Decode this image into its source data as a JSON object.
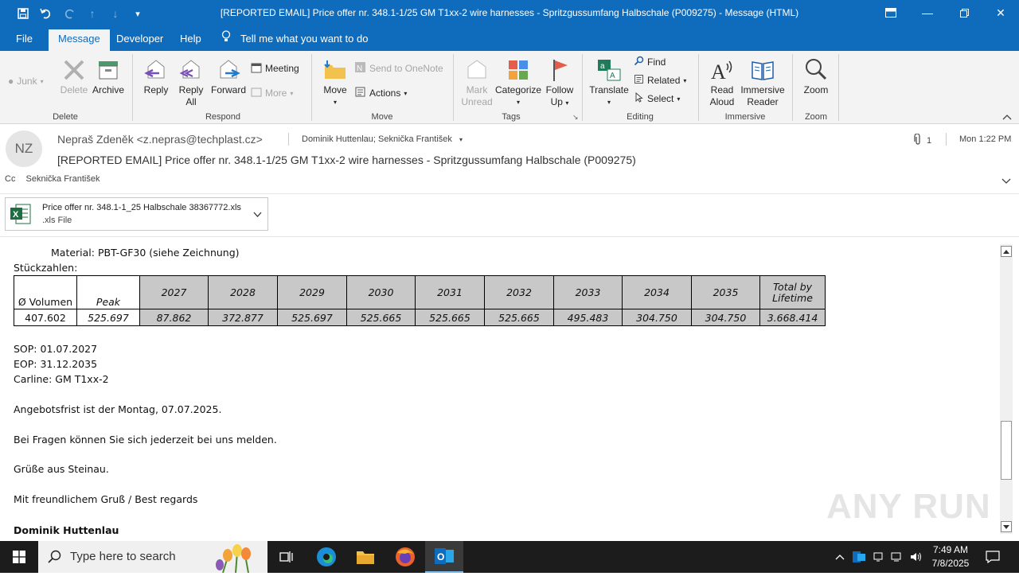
{
  "window": {
    "title": "[REPORTED EMAIL] Price offer nr. 348.1-1/25 GM T1xx-2 wire harnesses - Spritzgussumfang Halbschale (P009275)  -  Message (HTML)"
  },
  "tabs": [
    "File",
    "Message",
    "Developer",
    "Help"
  ],
  "tell_me": "Tell me what you want to do",
  "ribbon": {
    "delete_group": {
      "label": "Delete",
      "junk": "Junk",
      "delete": "Delete",
      "archive": "Archive"
    },
    "respond_group": {
      "label": "Respond",
      "reply": "Reply",
      "reply_all_1": "Reply",
      "reply_all_2": "All",
      "forward": "Forward",
      "meeting": "Meeting",
      "more": "More"
    },
    "move_group": {
      "label": "Move",
      "move": "Move",
      "send_onenote": "Send to OneNote",
      "actions": "Actions"
    },
    "tags_group": {
      "label": "Tags",
      "mark_unread_1": "Mark",
      "mark_unread_2": "Unread",
      "categorize": "Categorize",
      "follow_up_1": "Follow",
      "follow_up_2": "Up"
    },
    "editing_group": {
      "label": "Editing",
      "translate": "Translate",
      "find": "Find",
      "related": "Related",
      "select": "Select"
    },
    "immersive_group": {
      "label": "Immersive",
      "read_aloud_1": "Read",
      "read_aloud_2": "Aloud",
      "immersive_reader_1": "Immersive",
      "immersive_reader_2": "Reader"
    },
    "zoom_group": {
      "label": "Zoom",
      "zoom": "Zoom"
    }
  },
  "message": {
    "avatar_initials": "NZ",
    "sender": "Nepraš Zdeněk <z.nepras@techplast.cz>",
    "recipients": "Dominik Huttenlau; Seknička František",
    "attachment_count": "1",
    "date": "Mon 1:22 PM",
    "subject": "[REPORTED EMAIL] Price offer nr. 348.1-1/25 GM T1xx-2 wire harnesses - Spritzgussumfang Halbschale (P009275)",
    "cc_label": "Cc",
    "cc": "Seknička František"
  },
  "attachment": {
    "name": "Price offer nr. 348.1-1_25 Halbschale 38367772.xls",
    "type": ".xls File"
  },
  "body": {
    "material": "Material: PBT-GF30 (siehe Zeichnung)",
    "stueckzahlen": "Stückzahlen:",
    "sop": "SOP: 01.07.2027",
    "eop": "EOP: 31.12.2035",
    "carline": "Carline: GM T1xx-2",
    "deadline": "Angebotsfrist ist der Montag, 07.07.2025.",
    "questions": "Bei Fragen können Sie sich jederzeit bei uns melden.",
    "greeting": "Grüße aus Steinau.",
    "regards": "Mit freundlichem Gruß / Best regards",
    "signature": "Dominik Huttenlau"
  },
  "volume_table": {
    "headers": [
      "Ø Volumen",
      "Peak",
      "2027",
      "2028",
      "2029",
      "2030",
      "2031",
      "2032",
      "2033",
      "2034",
      "2035",
      "Total by Lifetime"
    ],
    "values": [
      "407.602",
      "525.697",
      "87.862",
      "372.877",
      "525.697",
      "525.665",
      "525.665",
      "525.665",
      "495.483",
      "304.750",
      "304.750",
      "3.668.414"
    ]
  },
  "taskbar": {
    "search_placeholder": "Type here to search",
    "time": "7:49 AM",
    "date": "7/8/2025"
  },
  "watermark": "ANY RUN",
  "colors": {
    "accent": "#0f6cbd",
    "ribbon_bg": "#f3f3f3",
    "table_header_gray": "#c8c8c8"
  }
}
